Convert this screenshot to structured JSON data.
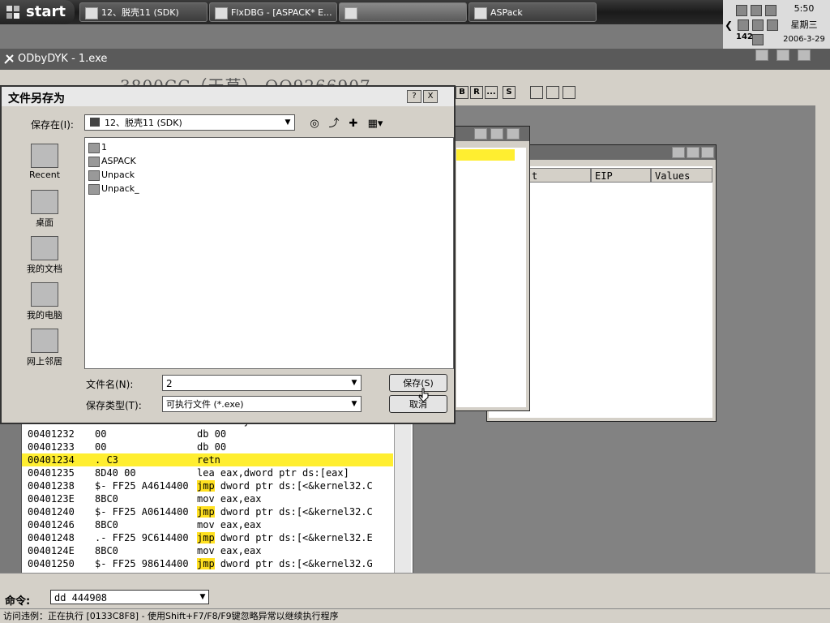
{
  "taskbar": {
    "start_label": "start",
    "tasks": [
      {
        "label": "12、脱壳11 (SDK)"
      },
      {
        "label": "FlxDBG - [ASPACK* E..."
      },
      {
        "label": ""
      },
      {
        "label": "ASPack"
      }
    ],
    "clock": "5:50",
    "weekday": "星期三",
    "tray_number": "142",
    "date": "2006-3-29"
  },
  "olly": {
    "title": "ODbyDYK - 1.exe",
    "watermark": "3800CC（天草） QQ9266907",
    "toolbar_buttons": [
      "B",
      "R",
      "...",
      "S"
    ]
  },
  "disassembly": {
    "rows": [
      {
        "addr": "00401232",
        "hex": "00",
        "asm_kw": "",
        "asm": "db 00",
        "highlight": false
      },
      {
        "addr": "00401233",
        "hex": "00",
        "asm_kw": "",
        "asm": "db 00",
        "highlight": false
      },
      {
        "addr": "00401234",
        "hex": ".  C3",
        "asm_kw": "",
        "asm": "retn",
        "highlight": true
      },
      {
        "addr": "00401235",
        "hex": "8D40 00",
        "asm_kw": "",
        "asm": "lea eax,dword ptr ds:[eax]",
        "highlight": false
      },
      {
        "addr": "00401238",
        "hex": "$- FF25 A4614400",
        "asm_kw": "jmp",
        "asm": " dword ptr ds:[<&kernel32.C",
        "highlight": false
      },
      {
        "addr": "0040123E",
        "hex": "8BC0",
        "asm_kw": "",
        "asm": "mov eax,eax",
        "highlight": false
      },
      {
        "addr": "00401240",
        "hex": "$- FF25 A0614400",
        "asm_kw": "jmp",
        "asm": " dword ptr ds:[<&kernel32.C",
        "highlight": false
      },
      {
        "addr": "00401246",
        "hex": "8BC0",
        "asm_kw": "",
        "asm": "mov eax,eax",
        "highlight": false
      },
      {
        "addr": "00401248",
        "hex": ".- FF25 9C614400",
        "asm_kw": "jmp",
        "asm": " dword ptr ds:[<&kernel32.E",
        "highlight": false
      },
      {
        "addr": "0040124E",
        "hex": "8BC0",
        "asm_kw": "",
        "asm": "mov eax,eax",
        "highlight": false
      },
      {
        "addr": "00401250",
        "hex": "$- FF25 98614400",
        "asm_kw": "jmp",
        "asm": " dword ptr ds:[<&kernel32.G",
        "highlight": false
      }
    ]
  },
  "bg_window": {
    "columns": [
      "t",
      "EIP",
      "Values"
    ]
  },
  "command": {
    "label": "命令:",
    "value": "dd 444908"
  },
  "status": "访问违例：正在执行 [0133C8F8] - 使用Shift+F7/F8/F9键忽略异常以继续执行程序",
  "dialog": {
    "title": "文件另存为",
    "help": "?",
    "close": "X",
    "savein_label": "保存在(I):",
    "savein_value": "12、脱壳11 (SDK)",
    "places": [
      {
        "label": "Recent",
        "icon": "recent-icon"
      },
      {
        "label": "桌面",
        "icon": "desktop-icon"
      },
      {
        "label": "我的文档",
        "icon": "my-documents-icon"
      },
      {
        "label": "我的电脑",
        "icon": "my-computer-icon"
      },
      {
        "label": "网上邻居",
        "icon": "network-places-icon"
      }
    ],
    "files": [
      "1",
      "ASPACK",
      "Unpack",
      "Unpack_"
    ],
    "filename_label": "文件名(N):",
    "filename_value": "2",
    "filetype_label": "保存类型(T):",
    "filetype_value": "可执行文件 (*.exe)",
    "save_button": "保存(S)",
    "cancel_button": "取消"
  }
}
